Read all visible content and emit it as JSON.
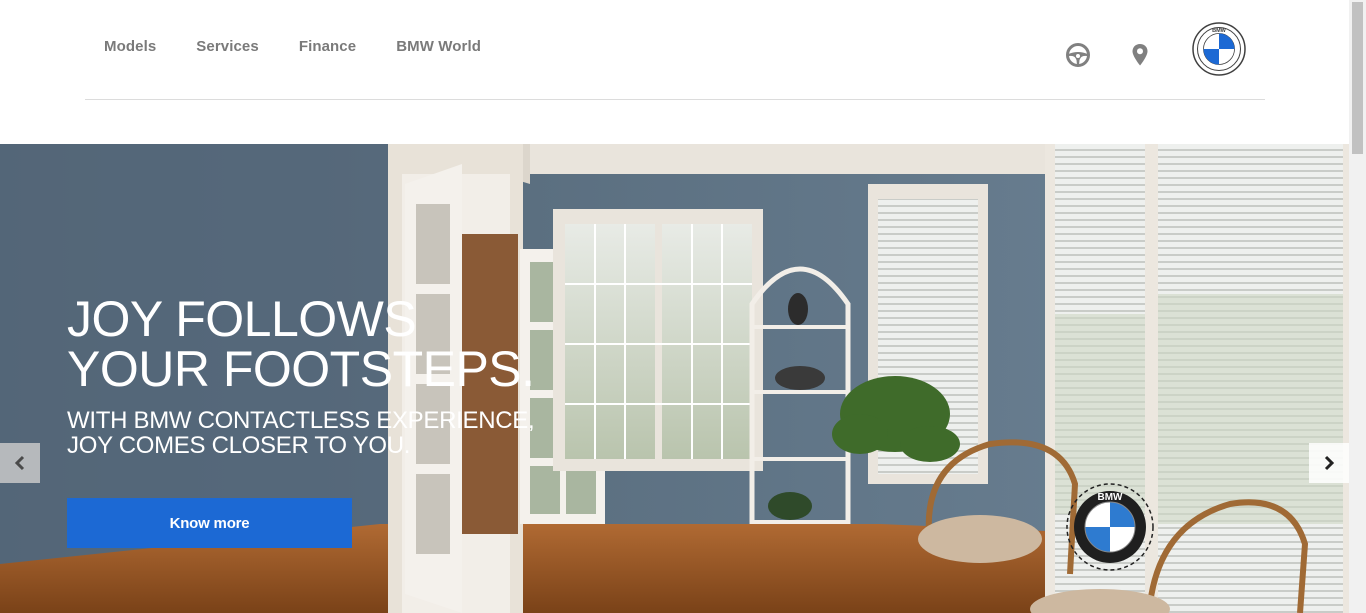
{
  "nav": {
    "items": [
      "Models",
      "Services",
      "Finance",
      "BMW World"
    ]
  },
  "header_icons": {
    "test_drive": "steering-wheel-icon",
    "locator": "location-pin-icon",
    "logo": "bmw-logo"
  },
  "hero": {
    "title": "JOY FOLLOWS\nYOUR FOOTSTEPS.",
    "subtitle": "WITH BMW CONTACTLESS EXPERIENCE, JOY COMES CLOSER TO YOU.",
    "cta_label": "Know more",
    "prev_icon": "chevron-left-icon",
    "next_icon": "chevron-right-icon"
  },
  "logo_text": "BMW",
  "colors": {
    "accent": "#1c69d4",
    "nav_text": "#7a7a7a",
    "bmw_blue": "#1c69d4"
  }
}
